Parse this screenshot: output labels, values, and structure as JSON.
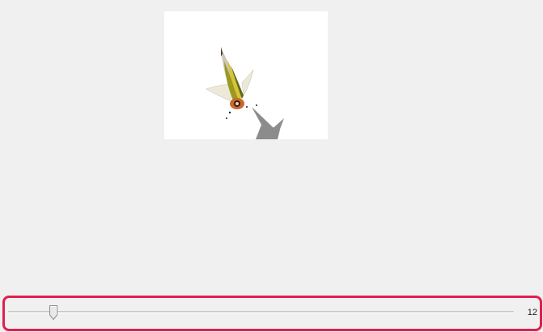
{
  "image_view": {
    "icon": "insect-specimen-image"
  },
  "slider": {
    "value": "12",
    "fraction": 0.09,
    "highlight_color": "#e0204f"
  }
}
